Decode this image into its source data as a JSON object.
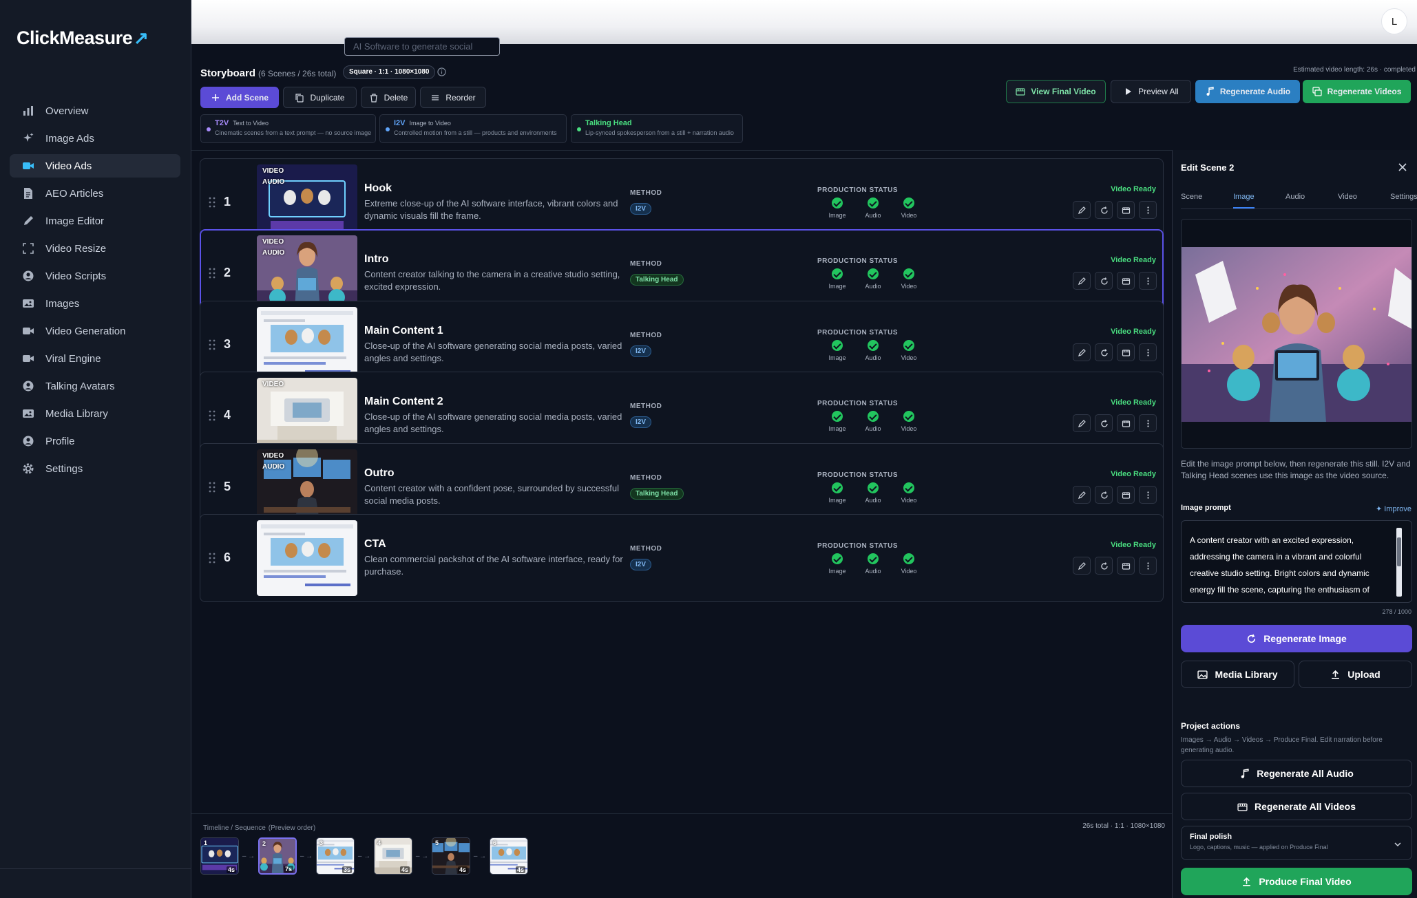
{
  "app": {
    "logo": "ClickMeasure",
    "avatar": "L"
  },
  "sidebar": {
    "items": [
      {
        "label": "Overview",
        "icon": "bar-chart-icon"
      },
      {
        "label": "Image Ads",
        "icon": "sparkles-icon"
      },
      {
        "label": "Video Ads",
        "icon": "video-camera-icon",
        "active": true
      },
      {
        "label": "AEO Articles",
        "icon": "document-icon"
      },
      {
        "label": "Image Editor",
        "icon": "pencil-icon"
      },
      {
        "label": "Video Resize",
        "icon": "resize-icon"
      },
      {
        "label": "Video Scripts",
        "icon": "user-circle-icon"
      },
      {
        "label": "Images",
        "icon": "image-icon"
      },
      {
        "label": "Video Generation",
        "icon": "video-camera-icon"
      },
      {
        "label": "Viral Engine",
        "icon": "video-camera-icon"
      },
      {
        "label": "Talking Avatars",
        "icon": "user-circle-icon"
      },
      {
        "label": "Media Library",
        "icon": "image-icon"
      },
      {
        "label": "Profile",
        "icon": "user-circle-icon"
      },
      {
        "label": "Settings",
        "icon": "gear-icon"
      }
    ]
  },
  "topbar": {
    "project_input": "AI Software to generate social"
  },
  "storyboard": {
    "title": "Storyboard",
    "subtitle": "(6 Scenes / 26s total)",
    "format": "Square · 1:1 · 1080×1080",
    "estimate": "Estimated video length: 26s · completed",
    "toolbar": {
      "add": "Add Scene",
      "duplicate": "Duplicate",
      "delete": "Delete",
      "reorder": "Reorder",
      "view_final": "View Final Video",
      "preview_all": "Preview All",
      "regen_audio": "Regenerate Audio",
      "regen_videos": "Regenerate Videos"
    },
    "methods": [
      {
        "code": "T2V",
        "name": "Text to Video",
        "desc": "Cinematic scenes from a text prompt — no source image",
        "color": "#a78bfa"
      },
      {
        "code": "I2V",
        "name": "Image to Video",
        "desc": "Controlled motion from a still — products and environments",
        "color": "#60a5fa"
      },
      {
        "code": "Talking Head",
        "name": "",
        "desc": "Lip-synced spokesperson from a still + narration audio",
        "color": "#4ade80"
      }
    ],
    "labels": {
      "method": "METHOD",
      "production": "PRODUCTION STATUS",
      "image": "Image",
      "audio": "Audio",
      "video": "Video",
      "video_tag": "VIDEO",
      "audio_tag": "AUDIO"
    }
  },
  "scenes": [
    {
      "num": "1",
      "title": "Hook",
      "desc": "Extreme close-up of the AI software interface, vibrant colors and dynamic visuals fill the frame.",
      "method": "I2V",
      "status": "Video Ready",
      "duration": "4s",
      "tags": [
        "VIDEO",
        "AUDIO"
      ]
    },
    {
      "num": "2",
      "title": "Intro",
      "desc": "Content creator talking to the camera in a creative studio setting, excited expression.",
      "method": "Talking Head",
      "status": "Video Ready",
      "duration": "7s",
      "tags": [
        "VIDEO",
        "AUDIO"
      ]
    },
    {
      "num": "3",
      "title": "Main Content 1",
      "desc": "Close-up of the AI software generating social media posts, varied angles and settings.",
      "method": "I2V",
      "status": "Video Ready",
      "duration": "",
      "tags": []
    },
    {
      "num": "4",
      "title": "Main Content 2",
      "desc": "Close-up of the AI software generating social media posts, varied angles and settings.",
      "method": "I2V",
      "status": "Video Ready",
      "duration": "4s",
      "tags": [
        "VIDEO"
      ]
    },
    {
      "num": "5",
      "title": "Outro",
      "desc": "Content creator with a confident pose, surrounded by successful social media posts.",
      "method": "Talking Head",
      "status": "Video Ready",
      "duration": "4s",
      "tags": [
        "VIDEO",
        "AUDIO"
      ]
    },
    {
      "num": "6",
      "title": "CTA",
      "desc": "Clean commercial packshot of the AI software interface, ready for purchase.",
      "method": "I2V",
      "status": "Video Ready",
      "duration": "",
      "tags": []
    }
  ],
  "timeline": {
    "title": "Timeline / Sequence",
    "sub": "(Preview order)",
    "summary": "26s total · 1:1 · 1080×1080",
    "items": [
      {
        "n": "1",
        "d": "4s"
      },
      {
        "n": "2",
        "d": "7s"
      },
      {
        "n": "3",
        "d": "3s"
      },
      {
        "n": "4",
        "d": "4s"
      },
      {
        "n": "5",
        "d": "4s"
      },
      {
        "n": "6",
        "d": "4s"
      }
    ]
  },
  "panel": {
    "title": "Edit Scene 2",
    "tabs": [
      "Scene",
      "Image",
      "Audio",
      "Video",
      "Settings"
    ],
    "active_tab": "Image",
    "help": "Edit the image prompt below, then regenerate this still. I2V and Talking Head scenes use this image as the video source.",
    "prompt_label": "Image prompt",
    "improve": "Improve",
    "prompt": "A content creator with an excited expression, addressing the camera in a vibrant and colorful creative studio setting. Bright colors and dynamic energy fill the scene, capturing the enthusiasm of",
    "count": "278 / 1000",
    "regen_image": "Regenerate Image",
    "media_library": "Media Library",
    "upload": "Upload",
    "project_actions": "Project actions",
    "project_actions_desc": "Images → Audio → Videos → Produce Final. Edit narration before generating audio.",
    "regen_all_audio": "Regenerate All Audio",
    "regen_all_videos": "Regenerate All Videos",
    "polish_title": "Final polish",
    "polish_desc": "Logo, captions, music — applied on Produce Final",
    "produce": "Produce Final Video"
  }
}
